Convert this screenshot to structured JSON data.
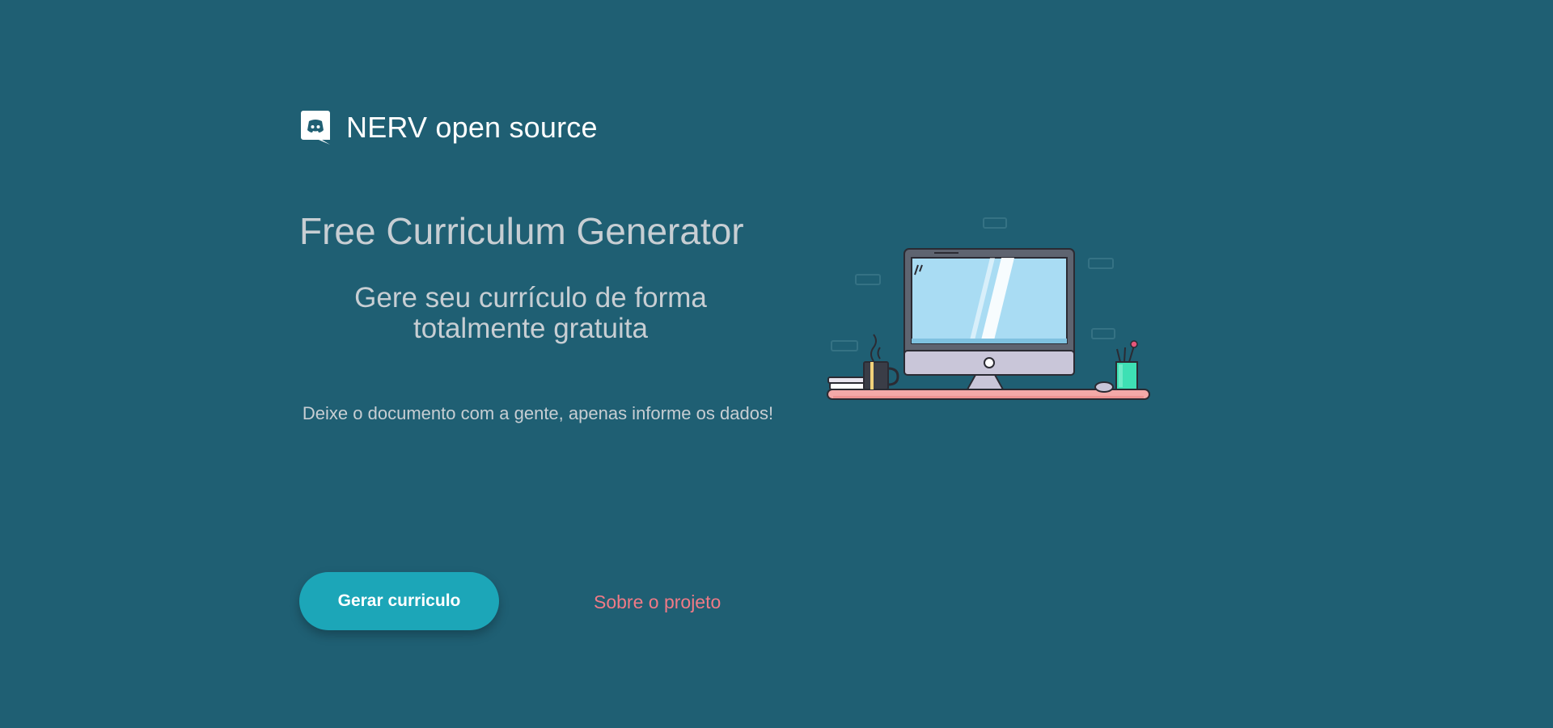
{
  "brand": {
    "name": "NERV open source",
    "icon": "discord-chat-bubble-icon"
  },
  "hero": {
    "title": "Free Curriculum Generator",
    "subtitle": "Gere seu currículo de forma totalmente gratuita",
    "description": "Deixe o documento com a gente, apenas informe os dados!"
  },
  "actions": {
    "primary_label": "Gerar curriculo",
    "secondary_label": "Sobre o projeto"
  },
  "illustration": {
    "subject": "desk-with-computer-illustration"
  },
  "colors": {
    "background": "#1f5f73",
    "primary_button": "#1ca6b8",
    "link": "#f07a86",
    "text_muted": "#c7ced3"
  }
}
